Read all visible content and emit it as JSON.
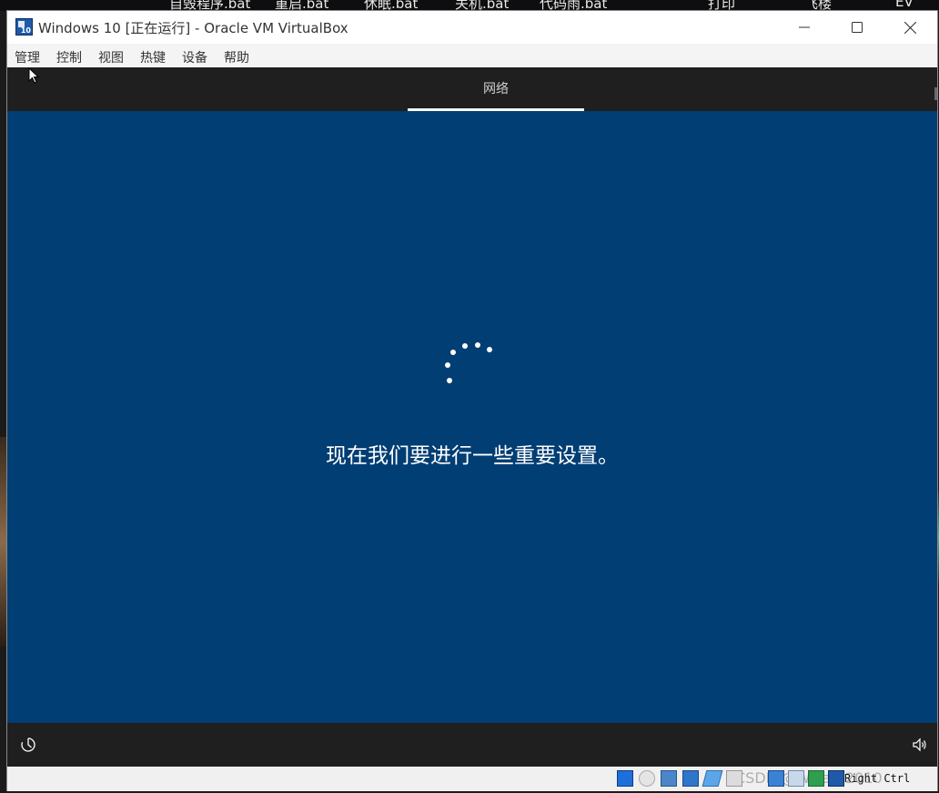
{
  "desktop": {
    "shortcuts": [
      "自毁程序.bat",
      "重启.bat",
      "休眠.bat",
      "关机.bat",
      "代码雨.bat",
      "打印",
      "飞楼",
      "EV"
    ]
  },
  "window": {
    "title": "Windows 10 [正在运行] - Oracle VM VirtualBox",
    "controls": {
      "minimize": "minimize",
      "maximize": "maximize",
      "close": "close"
    }
  },
  "menu": {
    "items": [
      "管理",
      "控制",
      "视图",
      "热键",
      "设备",
      "帮助"
    ]
  },
  "guest": {
    "tab_label": "网络",
    "message": "现在我们要进行一些重要设置。",
    "background_color": "#013e73"
  },
  "statusbar": {
    "hotkey": "Right Ctrl",
    "watermark": "CSDN @Willam2010"
  }
}
